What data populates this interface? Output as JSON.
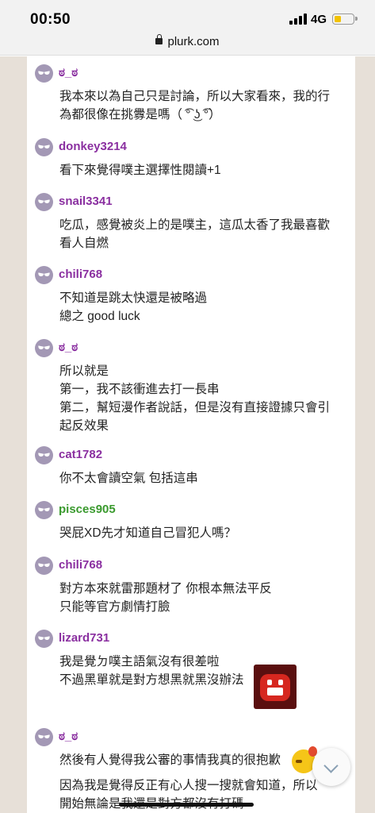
{
  "status_bar": {
    "time": "00:50",
    "network": "4G"
  },
  "browser": {
    "url": "plurk.com"
  },
  "responses": [
    {
      "user": "ʚ̴̶̷̷ɞ̴̶̷",
      "user_display": "ಠ_ಠ",
      "lines": [
        "我本來以為自己只是討論，所以大家看來，我的行",
        "為都很像在挑釁是嗎（ ͡° ͜ʖ ͡°）"
      ]
    },
    {
      "user_display": "donkey3214",
      "lines": [
        "看下來覺得噗主選擇性閱讀+1"
      ]
    },
    {
      "user_display": "snail3341",
      "lines": [
        "吃瓜，感覺被炎上的是噗主，這瓜太香了我最喜歡",
        "看人自燃"
      ]
    },
    {
      "user_display": "chili768",
      "lines": [
        "不知道是跳太快還是被略過",
        "總之 good luck"
      ]
    },
    {
      "user_display": "ಠ_ಠ",
      "lines": [
        "所以就是",
        "第一，我不該衝進去打一長串",
        "第二，幫短漫作者說話，但是沒有直接證據只會引",
        "起反效果"
      ]
    },
    {
      "user_display": "cat1782",
      "lines": [
        "你不太會讀空氣 包括這串"
      ]
    },
    {
      "user_display": "pisces905",
      "lines": [
        "哭屁XD先才知道自己冒犯人嗎？"
      ]
    },
    {
      "user_display": "chili768",
      "lines": [
        "對方本來就雷那題材了 你根本無法平反",
        "只能等官方劇情打臉"
      ]
    },
    {
      "user_display": "lizard731",
      "lines": [
        "我是覺ㄉ噗主語氣沒有很差啦",
        "不過黑單就是對方想黑就黑沒辦法"
      ]
    },
    {
      "user_display": "ಠ_ಠ",
      "lines": [
        "然後有人覺得我公審的事情我真的很抱歉",
        "因為我是覺得反正有心人搜一搜就會知道，所以",
        "開始無論是我還是對方都沒有打碼"
      ]
    }
  ],
  "colors": {
    "username": "#8a2fa0",
    "username_alt": "#3a9a2e",
    "sidebar": "#e7e0d8"
  }
}
